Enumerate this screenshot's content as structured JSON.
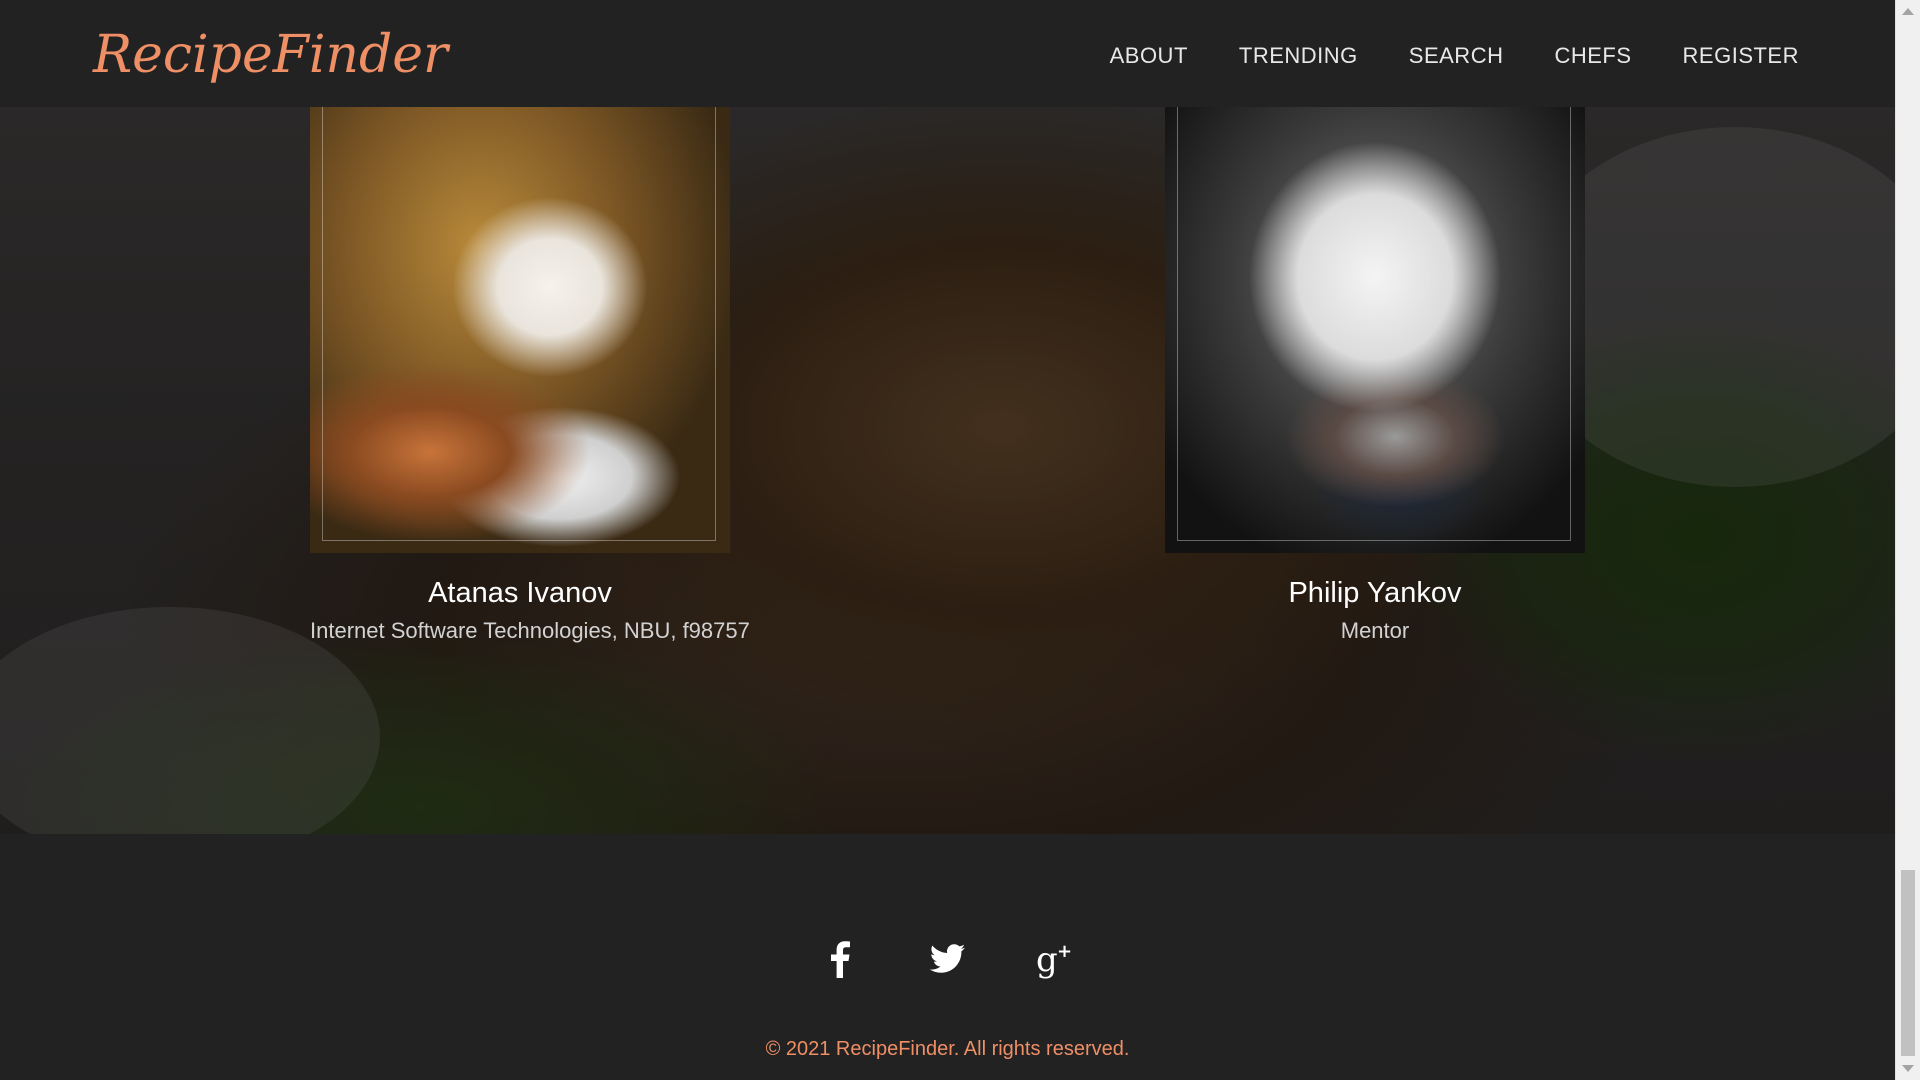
{
  "header": {
    "logo": "RecipeFinder",
    "nav": [
      "ABOUT",
      "TRENDING",
      "SEARCH",
      "CHEFS",
      "REGISTER"
    ]
  },
  "chefs": [
    {
      "name": "Atanas Ivanov",
      "role": "Internet Software Technologies, NBU, f98757"
    },
    {
      "name": "Philip Yankov",
      "role": "Mentor"
    }
  ],
  "footer": {
    "social_icons": [
      "facebook-icon",
      "twitter-icon",
      "google-plus-icon"
    ],
    "copyright": "© 2021 RecipeFinder. All rights reserved."
  },
  "colors": {
    "accent": "#ee8f66",
    "background": "#222222",
    "nav_text": "#e8e8e8"
  }
}
